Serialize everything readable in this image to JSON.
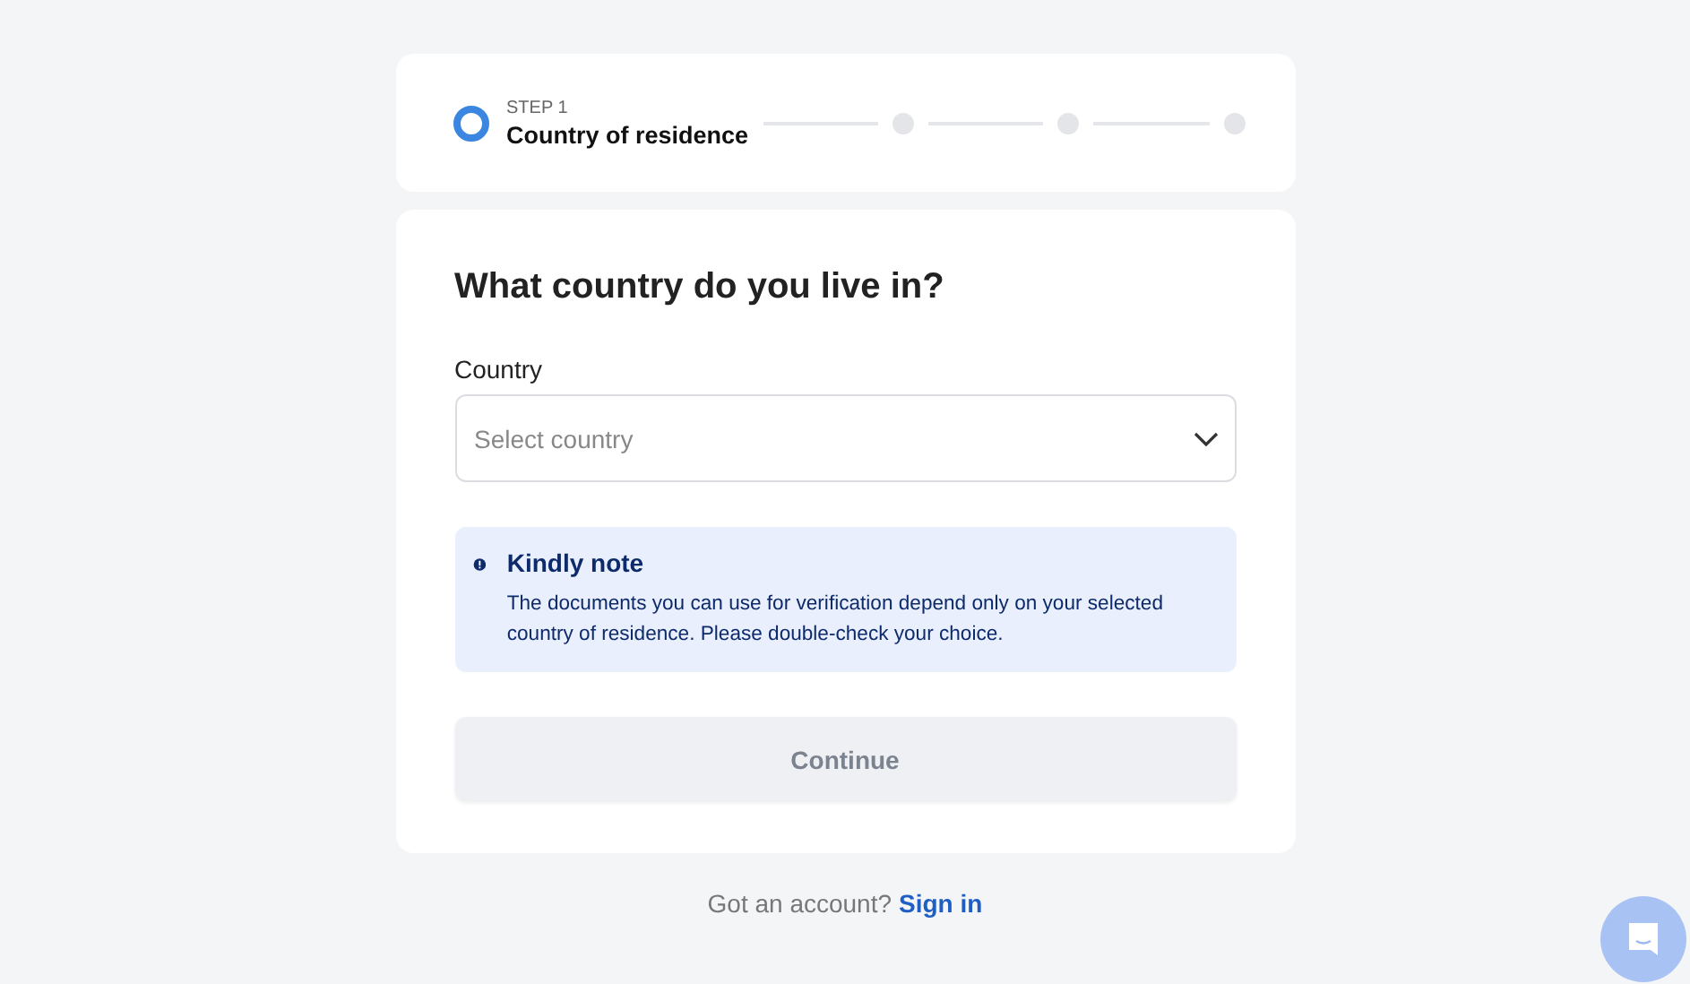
{
  "stepper": {
    "steps": [
      {
        "active": true,
        "caption": "STEP 1",
        "label": "Country of residence"
      },
      {
        "active": false
      },
      {
        "active": false
      },
      {
        "active": false
      }
    ]
  },
  "form": {
    "title": "What country do you live in?",
    "country_field": {
      "label": "Country",
      "placeholder": "Select country"
    },
    "note": {
      "title": "Kindly note",
      "text": "The documents you can use for verification depend only on your selected country of residence. Please double-check your choice."
    },
    "continue_button": {
      "label": "Continue",
      "disabled": true
    }
  },
  "footer": {
    "text": "Got an account?",
    "link": "Sign in"
  }
}
